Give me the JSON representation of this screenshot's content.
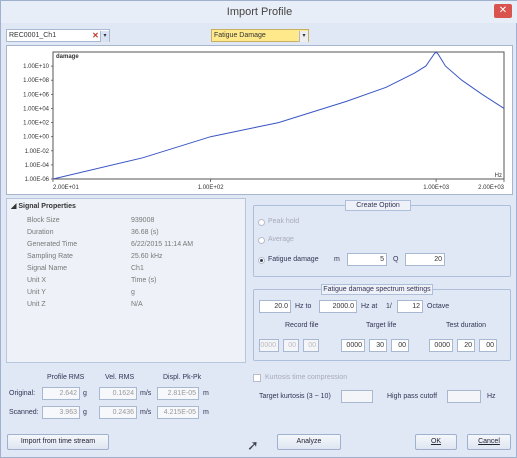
{
  "window": {
    "title": "Import Profile"
  },
  "toolbar": {
    "channel": "REC0001_Ch1",
    "damage_type": "Fatigue Damage"
  },
  "chart_data": {
    "type": "line",
    "title": "damage",
    "xlabel": "Hz",
    "x_scale": "log",
    "y_scale": "log",
    "xlim": [
      20,
      2000
    ],
    "ylim": [
      1e-06,
      1000000000000.0
    ],
    "x_ticks": [
      "2.00E+01",
      "1.00E+02",
      "1.00E+03",
      "2.00E+03"
    ],
    "y_ticks": [
      "1.00E+10",
      "1.00E+08",
      "1.00E+06",
      "1.00E+04",
      "1.00E+02",
      "1.00E+00",
      "1.00E-02",
      "1.00E-04",
      "1.00E-06"
    ],
    "series": [
      {
        "color": "#3a56c4",
        "x": [
          20,
          50,
          100,
          200,
          400,
          600,
          800,
          900,
          980,
          1000,
          1020,
          1100,
          1300,
          1600,
          2000
        ],
        "y": [
          1e-06,
          0.001,
          1.0,
          100.0,
          100000.0,
          10000000.0,
          1000000000.0,
          10000000000.0,
          500000000000.0,
          1000000000000.0,
          500000000000.0,
          10000000000.0,
          100000000.0,
          1000000.0,
          10000.0
        ]
      }
    ]
  },
  "props": {
    "header": "Signal Properties",
    "rows": [
      {
        "k": "Block Size",
        "v": "939008"
      },
      {
        "k": "Duration",
        "v": "36.68 (s)"
      },
      {
        "k": "Generated Time",
        "v": "6/22/2015 11:14 AM"
      },
      {
        "k": "Sampling Rate",
        "v": "25.60 kHz"
      },
      {
        "k": "Signal Name",
        "v": "Ch1"
      },
      {
        "k": "Unit X",
        "v": "Time (s)"
      },
      {
        "k": "Unit Y",
        "v": "g"
      },
      {
        "k": "Unit Z",
        "v": "N/A"
      }
    ]
  },
  "rms": {
    "headers": [
      "Profile RMS",
      "Vel. RMS",
      "Displ. Pk-Pk"
    ],
    "original": {
      "label": "Original:",
      "profile": "2.642",
      "profile_unit": "g",
      "vel": "0.1624",
      "vel_unit": "m/s",
      "displ": "2.81E-05",
      "displ_unit": "m"
    },
    "scanned": {
      "label": "Scanned:",
      "profile": "3.963",
      "profile_unit": "g",
      "vel": "0.2436",
      "vel_unit": "m/s",
      "displ": "4.215E-05",
      "displ_unit": "m"
    }
  },
  "create_option": {
    "title": "Create Option",
    "peak_hold": "Peak hold",
    "average": "Average",
    "fatigue": "Fatigue damage",
    "m_label": "m",
    "m_value": "5",
    "q_label": "Q",
    "q_value": "20"
  },
  "spectrum": {
    "title": "Fatigue damage spectrum settings",
    "from_hz": "20.0",
    "hz_to": "Hz to",
    "to_hz": "2000.0",
    "hz_at": "Hz at",
    "one_over": "1/",
    "octave_value": "12",
    "octave": "Octave",
    "record_file": "Record file",
    "target_life": "Target life",
    "test_duration": "Test duration",
    "record": [
      "0000",
      "00",
      "00"
    ],
    "target": [
      "0000",
      "30",
      "00"
    ],
    "test": [
      "0000",
      "20",
      "00"
    ]
  },
  "kurtosis": {
    "compression": "Kurtosis time compression",
    "target": "Target kurtosis (3 ~ 10)",
    "high_pass": "High pass cutoff",
    "hz": "Hz"
  },
  "buttons": {
    "import_stream": "Import from time stream",
    "analyze": "Analyze",
    "ok": "OK",
    "cancel": "Cancel"
  },
  "icons": {
    "close": "close-icon",
    "dropdown": "chevron-down-icon",
    "clear": "clear-x-icon",
    "collapse": "triangle-collapse-icon"
  }
}
